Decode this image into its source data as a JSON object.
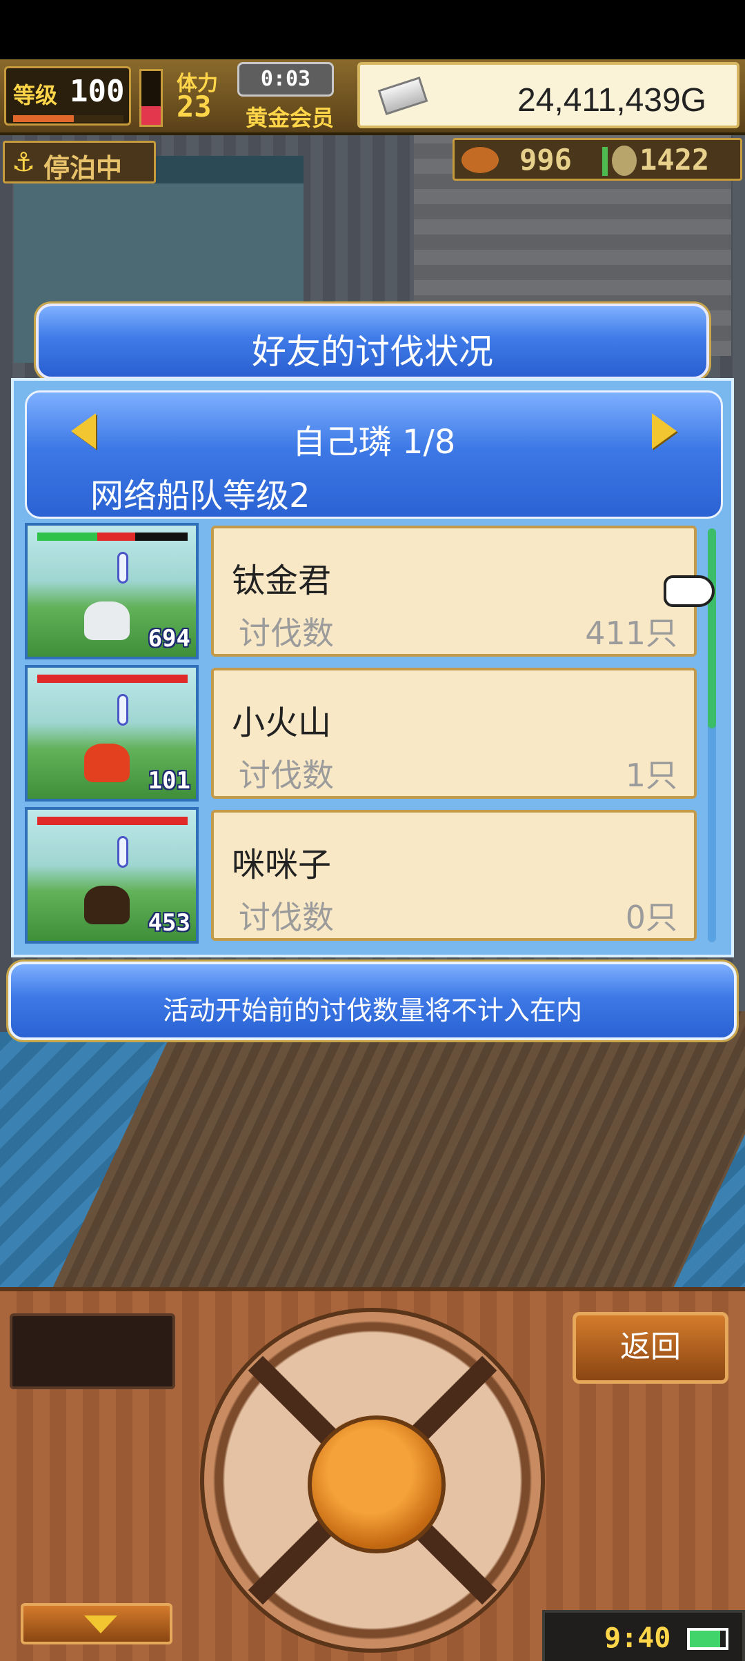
{
  "hud": {
    "level_label": "等级",
    "level_value": "100",
    "stamina_label": "体力",
    "stamina_value": "23",
    "stamina_fraction": 0.35,
    "timer": "0:03",
    "gold_member": "黄金会员",
    "gold_amount": "24,411,439G",
    "status": "停泊中",
    "resource_a": "996",
    "resource_b": "1422"
  },
  "dialog": {
    "title": "好友的讨伐状况",
    "player_name": "自己璘 1/8",
    "fleet_level": "网络船队等级2",
    "footer_note": "活动开始前的讨伐数量将不计入在内"
  },
  "entries": [
    {
      "name": "钛金君",
      "kill_label": "讨伐数",
      "kill_value": "411只",
      "monster_count": "694",
      "monster_color": "#e8ecef",
      "hp": [
        0.4,
        0.25
      ]
    },
    {
      "name": "小火山",
      "kill_label": "讨伐数",
      "kill_value": "1只",
      "monster_count": "101",
      "monster_color": "#e2401e",
      "hp": [
        0.0,
        1.0
      ]
    },
    {
      "name": "咪咪子",
      "kill_label": "讨伐数",
      "kill_value": "0只",
      "monster_count": "453",
      "monster_color": "#3a2514",
      "hp": [
        0.0,
        1.0
      ]
    }
  ],
  "controls": {
    "back_label": "返回",
    "clock": "9:40",
    "battery_fraction": 0.85
  },
  "colors": {
    "hp_green": "#2ec24a",
    "hp_red": "#e02a2a",
    "dialog_blue": "#3d79e6",
    "card_bg": "#f8e8c6"
  },
  "icons": {
    "anchor": "anchor-icon",
    "silver_bar": "silver-bar-icon",
    "hand_pointer": "hand-pointer-icon",
    "arrow_left": "arrow-left-icon",
    "arrow_right": "arrow-right-icon",
    "down_arrow": "down-arrow-icon",
    "battery": "battery-icon"
  }
}
